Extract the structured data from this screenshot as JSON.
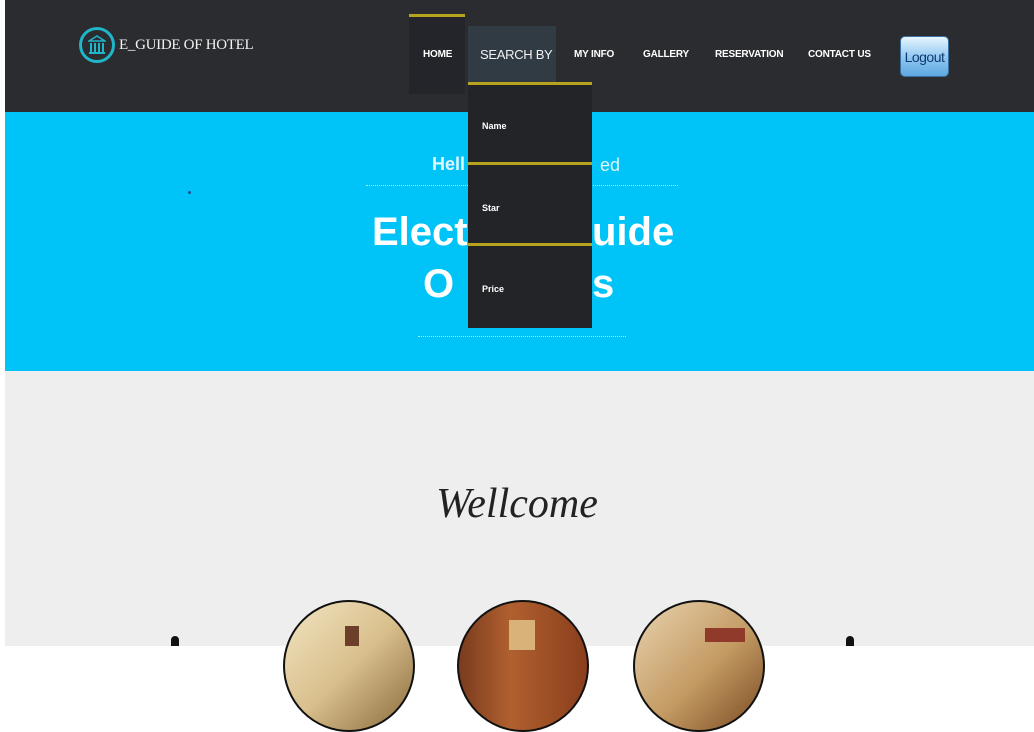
{
  "header": {
    "logo_text": "E_GUIDE OF HOTEL",
    "nav": {
      "home": "HOME",
      "search_by": "SEARCH BY",
      "my_info": "MY INFO",
      "gallery": "GALLERY",
      "reservation": "RESERVATION",
      "contact_us": "CONTACT US"
    },
    "logout": "Logout"
  },
  "search_dropdown": {
    "items": [
      "Name",
      "Star",
      "Price"
    ]
  },
  "hero": {
    "greeting_start": "Hell",
    "greeting_end": "ed",
    "title_line1_start": "Elect",
    "title_line1_end": "uide",
    "title_line2_start": "O",
    "title_line2_end": "s"
  },
  "welcome": {
    "heading": "Wellcome"
  },
  "colors": {
    "header_bg": "#2b2c30",
    "hero_bg": "#00c4f7",
    "accent": "#b8a31f",
    "logo_ring": "#1fb6c9"
  }
}
